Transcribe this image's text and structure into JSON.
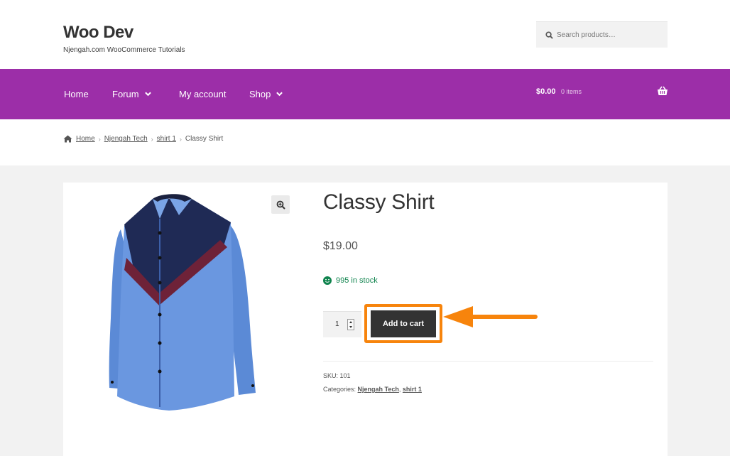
{
  "header": {
    "site_title": "Woo Dev",
    "site_description": "Njengah.com WooCommerce Tutorials",
    "search_placeholder": "Search products…"
  },
  "nav": {
    "items": [
      {
        "label": "Home"
      },
      {
        "label": "Forum"
      },
      {
        "label": "My account"
      },
      {
        "label": "Shop"
      }
    ],
    "cart_total": "$0.00",
    "cart_count": "0 items"
  },
  "breadcrumb": {
    "items": [
      "Home",
      "Njengah Tech",
      "shirt 1"
    ],
    "current": "Classy Shirt"
  },
  "product": {
    "title": "Classy Shirt",
    "price": "$19.00",
    "stock": "995 in stock",
    "quantity": "1",
    "add_to_cart_label": "Add to cart",
    "sku_label": "SKU:",
    "sku": "101",
    "categories_label": "Categories:",
    "categories": [
      "Njengah Tech",
      "shirt 1"
    ],
    "category_separator": ","
  },
  "colors": {
    "nav_bg": "#9c2ea8",
    "highlight": "#f7840c",
    "stock_green": "#0f834d",
    "button_bg": "#333333"
  }
}
